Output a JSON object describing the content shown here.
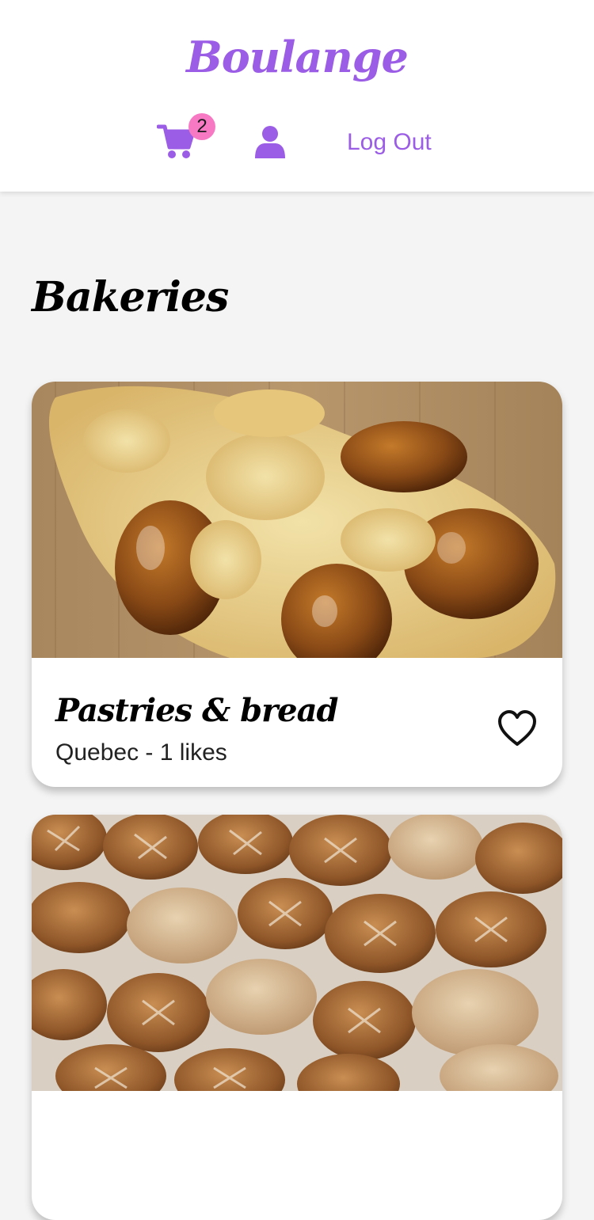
{
  "app": {
    "brand": "Boulange",
    "accent_color": "#9b5de5",
    "badge_color": "#f779c4"
  },
  "nav": {
    "cart_icon": "shopping-cart-icon",
    "cart_count": "2",
    "user_icon": "user-icon",
    "logout_label": "Log Out"
  },
  "main": {
    "title": "Bakeries",
    "cards": [
      {
        "title": "Pastries & bread",
        "subtitle": "Quebec - 1 likes",
        "image": "braided-bread-photo",
        "icon": "heart-outline-icon"
      },
      {
        "image": "bread-loaves-photo"
      }
    ]
  }
}
